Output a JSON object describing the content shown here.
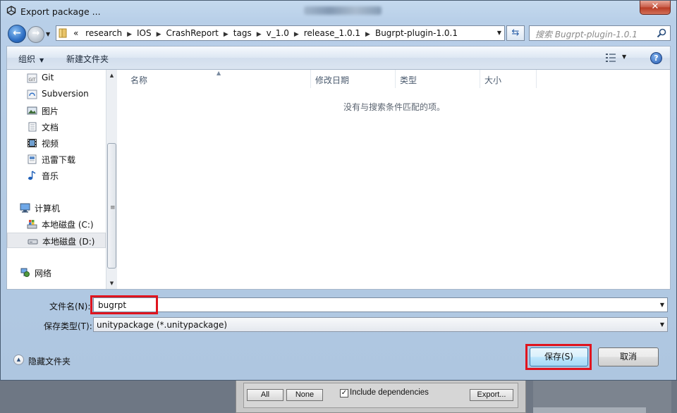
{
  "window": {
    "title": "Export package ..."
  },
  "address_bar": {
    "overflow": "«",
    "path": [
      "research",
      "IOS",
      "CrashReport",
      "tags",
      "v_1.0",
      "release_1.0.1",
      "Bugrpt-plugin-1.0.1"
    ]
  },
  "search": {
    "placeholder": "搜索 Bugrpt-plugin-1.0.1"
  },
  "toolbar": {
    "organize": "组织",
    "new_folder": "新建文件夹"
  },
  "nav_pane": {
    "items": [
      {
        "label": "Git",
        "icon": "git-folder-icon"
      },
      {
        "label": "Subversion",
        "icon": "svn-folder-icon"
      },
      {
        "label": "图片",
        "icon": "pictures-icon"
      },
      {
        "label": "文档",
        "icon": "documents-icon"
      },
      {
        "label": "视频",
        "icon": "videos-icon"
      },
      {
        "label": "迅雷下载",
        "icon": "download-folder-icon"
      },
      {
        "label": "音乐",
        "icon": "music-icon"
      },
      {
        "label": "计算机",
        "icon": "computer-icon"
      },
      {
        "label": "本地磁盘 (C:)",
        "icon": "system-drive-icon"
      },
      {
        "label": "本地磁盘 (D:)",
        "icon": "drive-icon",
        "selected": true
      },
      {
        "label": "网络",
        "icon": "network-icon"
      }
    ]
  },
  "file_list": {
    "columns": [
      "名称",
      "修改日期",
      "类型",
      "大小"
    ],
    "empty_message": "没有与搜索条件匹配的项。"
  },
  "form": {
    "filename_label": "文件名(N):",
    "filename_value": "bugrpt",
    "filetype_label": "保存类型(T):",
    "filetype_value": "unitypackage (*.unitypackage)"
  },
  "footer": {
    "hide_folders": "隐藏文件夹",
    "save": "保存(S)",
    "cancel": "取消"
  },
  "background_panel": {
    "all": "All",
    "none": "None",
    "include_dependencies": "Include dependencies",
    "include_dependencies_checked": true,
    "export": "Export..."
  },
  "colors": {
    "highlight": "#e0141e",
    "accent": "#2a5db0"
  }
}
